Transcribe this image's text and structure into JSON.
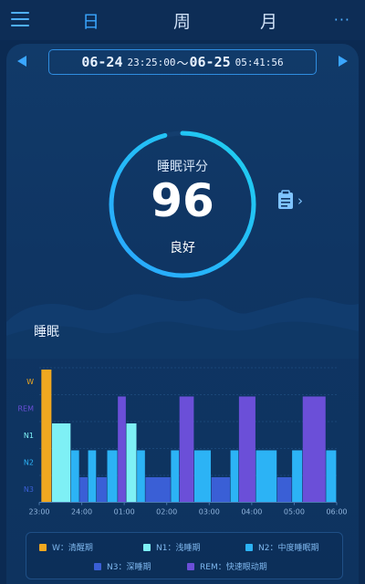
{
  "header": {
    "tabs": [
      {
        "label": "日",
        "active": true
      },
      {
        "label": "周",
        "active": false
      },
      {
        "label": "月",
        "active": false
      }
    ],
    "menu_icon": "hamburger-menu-icon",
    "more_label": "···"
  },
  "date_range": {
    "start_date": "06-24",
    "start_time": "23:25:00",
    "separator": "〜",
    "end_date": "06-25",
    "end_time": "05:41:56"
  },
  "score": {
    "label": "睡眠评分",
    "value": "96",
    "fraction": 0.96,
    "grade": "良好",
    "report_icon": "clipboard-icon",
    "chevron": "›"
  },
  "section": {
    "title": "睡眠"
  },
  "colors": {
    "accent": "#3aa6ff",
    "background": "#0b2a52",
    "W": "#f0a820",
    "N1": "#7ef0f5",
    "N2": "#2cb3f5",
    "N3": "#3a5fd6",
    "REM": "#6b4fd8"
  },
  "chart_data": {
    "type": "bar",
    "title": "",
    "stages": [
      "W",
      "REM",
      "N1",
      "N2",
      "N3"
    ],
    "x_ticks": [
      "23:00",
      "24:00",
      "01:00",
      "02:00",
      "03:00",
      "04:00",
      "05:00",
      "06:00"
    ],
    "xlim_hours": [
      0,
      7
    ],
    "segments": [
      {
        "stage": "W",
        "start": 0.05,
        "end": 0.3
      },
      {
        "stage": "N1",
        "start": 0.3,
        "end": 0.75
      },
      {
        "stage": "N2",
        "start": 0.75,
        "end": 0.95
      },
      {
        "stage": "N3",
        "start": 0.95,
        "end": 1.15
      },
      {
        "stage": "N2",
        "start": 1.15,
        "end": 1.35
      },
      {
        "stage": "N3",
        "start": 1.35,
        "end": 1.6
      },
      {
        "stage": "N2",
        "start": 1.6,
        "end": 1.85
      },
      {
        "stage": "REM",
        "start": 1.85,
        "end": 2.05
      },
      {
        "stage": "N1",
        "start": 2.05,
        "end": 2.3
      },
      {
        "stage": "N2",
        "start": 2.3,
        "end": 2.5
      },
      {
        "stage": "N3",
        "start": 2.5,
        "end": 3.1
      },
      {
        "stage": "N2",
        "start": 3.1,
        "end": 3.3
      },
      {
        "stage": "REM",
        "start": 3.3,
        "end": 3.65
      },
      {
        "stage": "N2",
        "start": 3.65,
        "end": 4.05
      },
      {
        "stage": "N3",
        "start": 4.05,
        "end": 4.5
      },
      {
        "stage": "N2",
        "start": 4.5,
        "end": 4.7
      },
      {
        "stage": "REM",
        "start": 4.7,
        "end": 5.1
      },
      {
        "stage": "N2",
        "start": 5.1,
        "end": 5.6
      },
      {
        "stage": "N3",
        "start": 5.6,
        "end": 5.95
      },
      {
        "stage": "N2",
        "start": 5.95,
        "end": 6.2
      },
      {
        "stage": "REM",
        "start": 6.2,
        "end": 6.75
      },
      {
        "stage": "N2",
        "start": 6.75,
        "end": 7.0
      }
    ]
  },
  "legend": [
    {
      "key": "W",
      "label": "W：清醒期"
    },
    {
      "key": "N1",
      "label": "N1：浅睡期"
    },
    {
      "key": "N2",
      "label": "N2：中度睡眠期"
    },
    {
      "key": "N3",
      "label": "N3：深睡期"
    },
    {
      "key": "REM",
      "label": "REM：快速眼动期"
    }
  ]
}
